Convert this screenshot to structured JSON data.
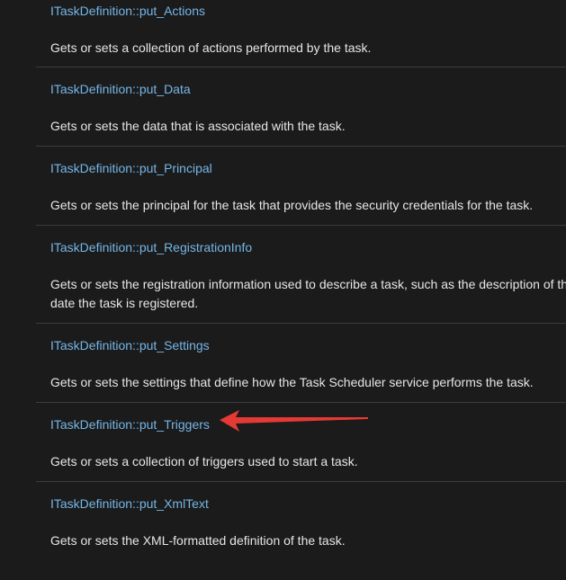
{
  "colors": {
    "background": "#1b1b1b",
    "link": "#75b6e7",
    "text": "#e6e6e6",
    "divider": "#3c3c3c",
    "annotation_arrow": "#e53935"
  },
  "members": [
    {
      "name": "ITaskDefinition::put_Actions",
      "description": [
        "Gets or sets a collection of actions performed by the task."
      ]
    },
    {
      "name": "ITaskDefinition::put_Data",
      "description": [
        "Gets or sets the data that is associated with the task."
      ]
    },
    {
      "name": "ITaskDefinition::put_Principal",
      "description": [
        "Gets or sets the principal for the task that provides the security credentials for the task."
      ]
    },
    {
      "name": "ITaskDefinition::put_RegistrationInfo",
      "description": [
        "Gets or sets the registration information used to describe a task, such as the description of th",
        "date the task is registered."
      ]
    },
    {
      "name": "ITaskDefinition::put_Settings",
      "description": [
        "Gets or sets the settings that define how the Task Scheduler service performs the task."
      ]
    },
    {
      "name": "ITaskDefinition::put_Triggers",
      "description": [
        "Gets or sets a collection of triggers used to start a task."
      ]
    },
    {
      "name": "ITaskDefinition::put_XmlText",
      "description": [
        "Gets or sets the XML-formatted definition of the task."
      ]
    }
  ],
  "annotation": {
    "icon": "red-arrow-icon",
    "target": "ITaskDefinition::put_Triggers"
  }
}
